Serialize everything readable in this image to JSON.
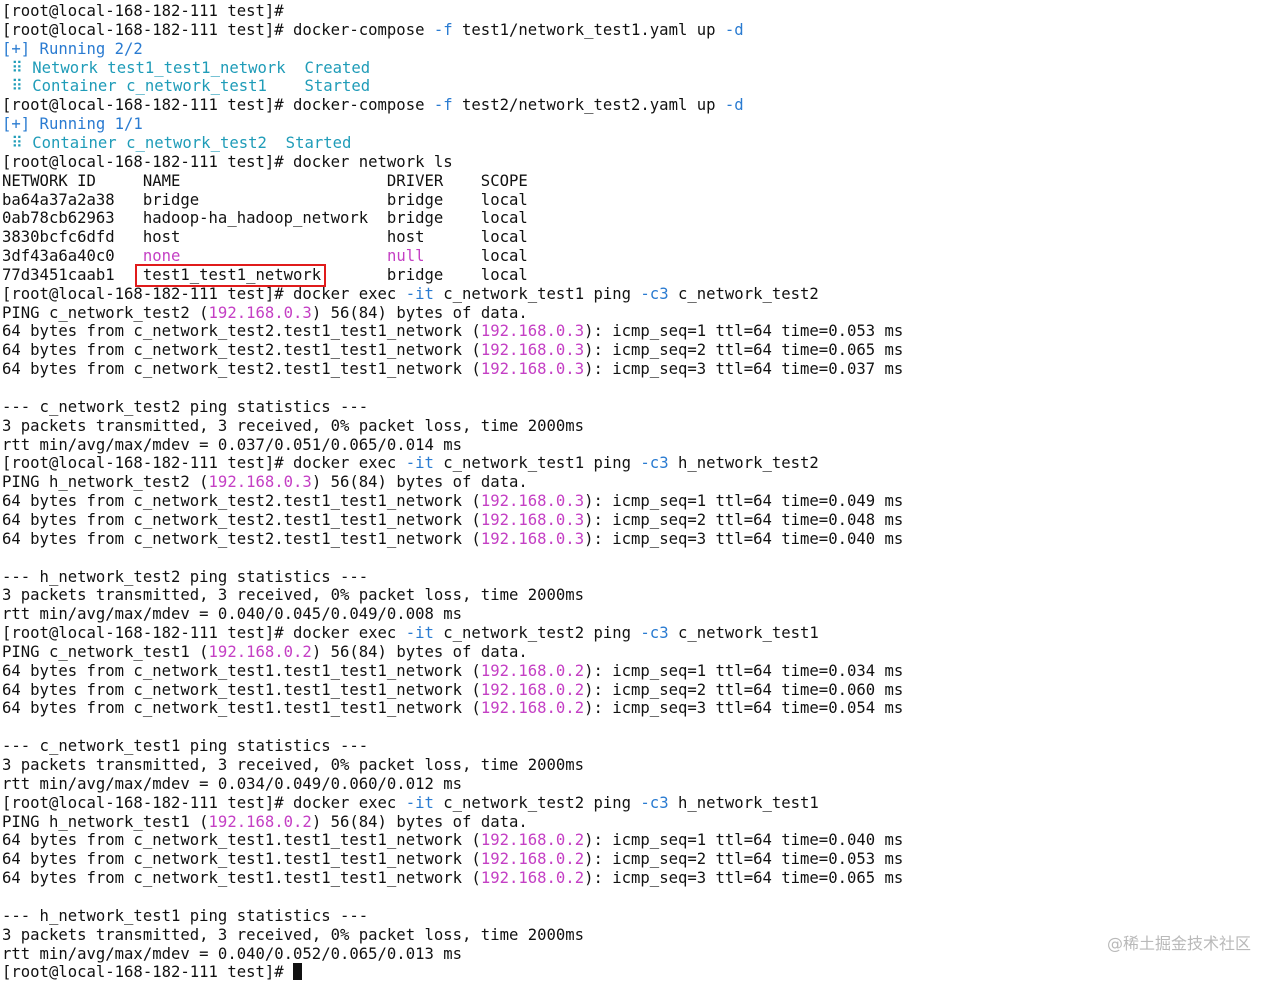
{
  "colors": {
    "background": "#ffffff",
    "text": "#111111",
    "flag_blue": "#2a7bd1",
    "ip_magenta": "#c43fc4",
    "status_cyan": "#1f9cb8",
    "highlight_red": "#e01b1b"
  },
  "highlight": {
    "line_index": 14,
    "text": "test1_test1_network"
  },
  "watermark": "@稀土掘金技术社区",
  "lines": [
    [
      [
        "cmd",
        "[root@local-168-182-111 test]#"
      ]
    ],
    [
      [
        "cmd",
        "[root@local-168-182-111 test]# docker-compose "
      ],
      [
        "flag",
        "-f"
      ],
      [
        "cmd",
        " test1/network_test1.yaml up "
      ],
      [
        "flag",
        "-d"
      ]
    ],
    [
      [
        "blue",
        "[+] Running 2/2"
      ]
    ],
    [
      [
        "cyan",
        " ⠿ Network test1_test1_network  Created"
      ]
    ],
    [
      [
        "cyan",
        " ⠿ Container c_network_test1    Started"
      ]
    ],
    [
      [
        "cmd",
        "[root@local-168-182-111 test]# docker-compose "
      ],
      [
        "flag",
        "-f"
      ],
      [
        "cmd",
        " test2/network_test2.yaml up "
      ],
      [
        "flag",
        "-d"
      ]
    ],
    [
      [
        "blue",
        "[+] Running 1/1"
      ]
    ],
    [
      [
        "cyan",
        " ⠿ Container c_network_test2  Started"
      ]
    ],
    [
      [
        "cmd",
        "[root@local-168-182-111 test]# docker network ls"
      ]
    ],
    [
      [
        "text",
        "NETWORK ID     NAME                      DRIVER    SCOPE"
      ]
    ],
    [
      [
        "text",
        "ba64a37a2a38   bridge                    bridge    local"
      ]
    ],
    [
      [
        "text",
        "0ab78cb62963   hadoop-ha_hadoop_network  bridge    local"
      ]
    ],
    [
      [
        "text",
        "3830bcfc6dfd   host                      host      local"
      ]
    ],
    [
      [
        "text",
        "3df43a6a40c0   "
      ],
      [
        "magenta",
        "none"
      ],
      [
        "text",
        "                      "
      ],
      [
        "magenta",
        "null"
      ],
      [
        "text",
        "      local"
      ]
    ],
    [
      [
        "text",
        "77d3451caab1   test1_test1_network       bridge    local"
      ]
    ],
    [
      [
        "cmd",
        "[root@local-168-182-111 test]# docker exec "
      ],
      [
        "flag",
        "-it"
      ],
      [
        "cmd",
        " c_network_test1 ping "
      ],
      [
        "flag",
        "-c3"
      ],
      [
        "cmd",
        " c_network_test2"
      ]
    ],
    [
      [
        "text",
        "PING c_network_test2 ("
      ],
      [
        "ip",
        "192.168.0.3"
      ],
      [
        "text",
        ") 56(84) bytes of data."
      ]
    ],
    [
      [
        "text",
        "64 bytes from c_network_test2.test1_test1_network ("
      ],
      [
        "ip",
        "192.168.0.3"
      ],
      [
        "text",
        "): icmp_seq=1 ttl=64 time=0.053 ms"
      ]
    ],
    [
      [
        "text",
        "64 bytes from c_network_test2.test1_test1_network ("
      ],
      [
        "ip",
        "192.168.0.3"
      ],
      [
        "text",
        "): icmp_seq=2 ttl=64 time=0.065 ms"
      ]
    ],
    [
      [
        "text",
        "64 bytes from c_network_test2.test1_test1_network ("
      ],
      [
        "ip",
        "192.168.0.3"
      ],
      [
        "text",
        "): icmp_seq=3 ttl=64 time=0.037 ms"
      ]
    ],
    [
      [
        "text",
        ""
      ]
    ],
    [
      [
        "text",
        "--- c_network_test2 ping statistics ---"
      ]
    ],
    [
      [
        "text",
        "3 packets transmitted, 3 received, 0% packet loss, time 2000ms"
      ]
    ],
    [
      [
        "text",
        "rtt min/avg/max/mdev = 0.037/0.051/0.065/0.014 ms"
      ]
    ],
    [
      [
        "cmd",
        "[root@local-168-182-111 test]# docker exec "
      ],
      [
        "flag",
        "-it"
      ],
      [
        "cmd",
        " c_network_test1 ping "
      ],
      [
        "flag",
        "-c3"
      ],
      [
        "cmd",
        " h_network_test2"
      ]
    ],
    [
      [
        "text",
        "PING h_network_test2 ("
      ],
      [
        "ip",
        "192.168.0.3"
      ],
      [
        "text",
        ") 56(84) bytes of data."
      ]
    ],
    [
      [
        "text",
        "64 bytes from c_network_test2.test1_test1_network ("
      ],
      [
        "ip",
        "192.168.0.3"
      ],
      [
        "text",
        "): icmp_seq=1 ttl=64 time=0.049 ms"
      ]
    ],
    [
      [
        "text",
        "64 bytes from c_network_test2.test1_test1_network ("
      ],
      [
        "ip",
        "192.168.0.3"
      ],
      [
        "text",
        "): icmp_seq=2 ttl=64 time=0.048 ms"
      ]
    ],
    [
      [
        "text",
        "64 bytes from c_network_test2.test1_test1_network ("
      ],
      [
        "ip",
        "192.168.0.3"
      ],
      [
        "text",
        "): icmp_seq=3 ttl=64 time=0.040 ms"
      ]
    ],
    [
      [
        "text",
        ""
      ]
    ],
    [
      [
        "text",
        "--- h_network_test2 ping statistics ---"
      ]
    ],
    [
      [
        "text",
        "3 packets transmitted, 3 received, 0% packet loss, time 2000ms"
      ]
    ],
    [
      [
        "text",
        "rtt min/avg/max/mdev = 0.040/0.045/0.049/0.008 ms"
      ]
    ],
    [
      [
        "cmd",
        "[root@local-168-182-111 test]# docker exec "
      ],
      [
        "flag",
        "-it"
      ],
      [
        "cmd",
        " c_network_test2 ping "
      ],
      [
        "flag",
        "-c3"
      ],
      [
        "cmd",
        " c_network_test1"
      ]
    ],
    [
      [
        "text",
        "PING c_network_test1 ("
      ],
      [
        "ip",
        "192.168.0.2"
      ],
      [
        "text",
        ") 56(84) bytes of data."
      ]
    ],
    [
      [
        "text",
        "64 bytes from c_network_test1.test1_test1_network ("
      ],
      [
        "ip",
        "192.168.0.2"
      ],
      [
        "text",
        "): icmp_seq=1 ttl=64 time=0.034 ms"
      ]
    ],
    [
      [
        "text",
        "64 bytes from c_network_test1.test1_test1_network ("
      ],
      [
        "ip",
        "192.168.0.2"
      ],
      [
        "text",
        "): icmp_seq=2 ttl=64 time=0.060 ms"
      ]
    ],
    [
      [
        "text",
        "64 bytes from c_network_test1.test1_test1_network ("
      ],
      [
        "ip",
        "192.168.0.2"
      ],
      [
        "text",
        "): icmp_seq=3 ttl=64 time=0.054 ms"
      ]
    ],
    [
      [
        "text",
        ""
      ]
    ],
    [
      [
        "text",
        "--- c_network_test1 ping statistics ---"
      ]
    ],
    [
      [
        "text",
        "3 packets transmitted, 3 received, 0% packet loss, time 2000ms"
      ]
    ],
    [
      [
        "text",
        "rtt min/avg/max/mdev = 0.034/0.049/0.060/0.012 ms"
      ]
    ],
    [
      [
        "cmd",
        "[root@local-168-182-111 test]# docker exec "
      ],
      [
        "flag",
        "-it"
      ],
      [
        "cmd",
        " c_network_test2 ping "
      ],
      [
        "flag",
        "-c3"
      ],
      [
        "cmd",
        " h_network_test1"
      ]
    ],
    [
      [
        "text",
        "PING h_network_test1 ("
      ],
      [
        "ip",
        "192.168.0.2"
      ],
      [
        "text",
        ") 56(84) bytes of data."
      ]
    ],
    [
      [
        "text",
        "64 bytes from c_network_test1.test1_test1_network ("
      ],
      [
        "ip",
        "192.168.0.2"
      ],
      [
        "text",
        "): icmp_seq=1 ttl=64 time=0.040 ms"
      ]
    ],
    [
      [
        "text",
        "64 bytes from c_network_test1.test1_test1_network ("
      ],
      [
        "ip",
        "192.168.0.2"
      ],
      [
        "text",
        "): icmp_seq=2 ttl=64 time=0.053 ms"
      ]
    ],
    [
      [
        "text",
        "64 bytes from c_network_test1.test1_test1_network ("
      ],
      [
        "ip",
        "192.168.0.2"
      ],
      [
        "text",
        "): icmp_seq=3 ttl=64 time=0.065 ms"
      ]
    ],
    [
      [
        "text",
        ""
      ]
    ],
    [
      [
        "text",
        "--- h_network_test1 ping statistics ---"
      ]
    ],
    [
      [
        "text",
        "3 packets transmitted, 3 received, 0% packet loss, time 2000ms"
      ]
    ],
    [
      [
        "text",
        "rtt min/avg/max/mdev = 0.040/0.052/0.065/0.013 ms"
      ]
    ],
    [
      [
        "cmd",
        "[root@local-168-182-111 test]# "
      ]
    ]
  ]
}
